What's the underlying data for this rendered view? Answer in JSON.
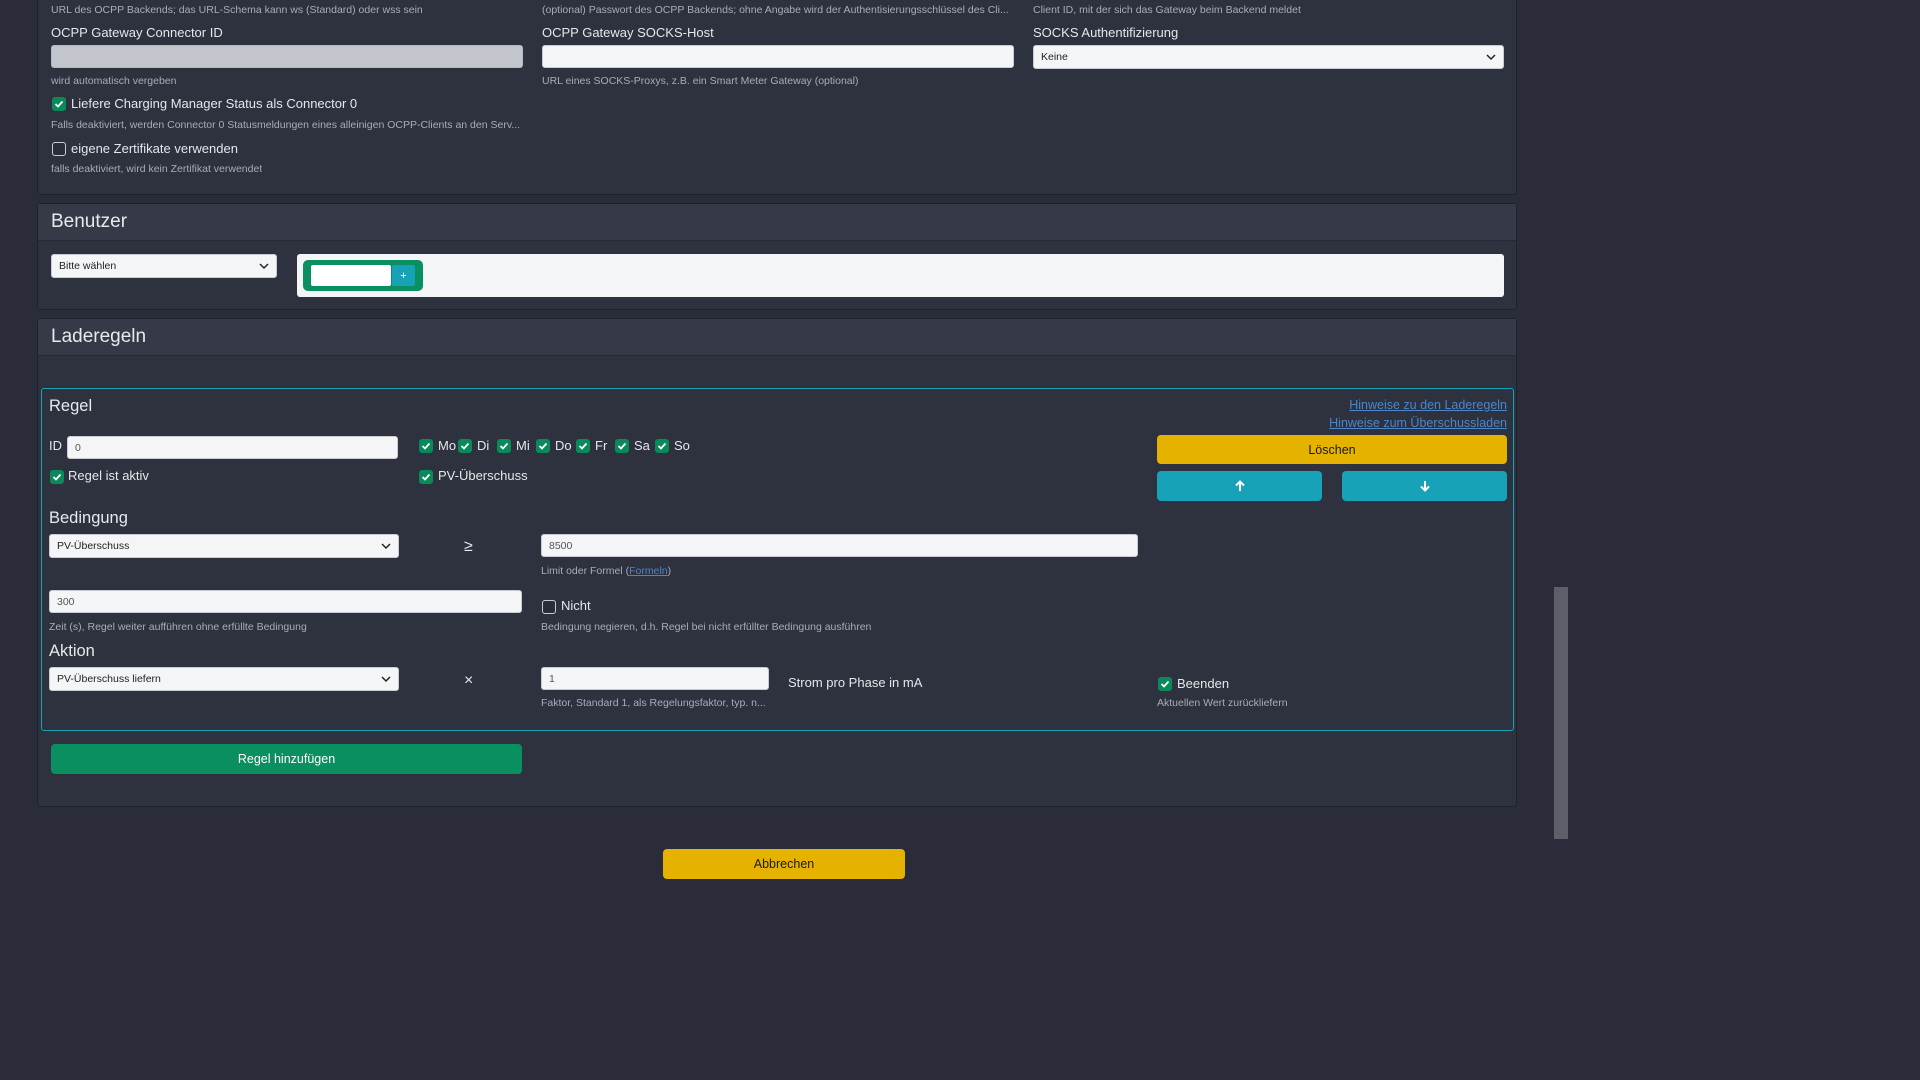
{
  "gateway": {
    "top_hints": {
      "url": "URL des OCPP Backends; das URL-Schema kann ws (Standard) oder wss sein",
      "password": "(optional) Passwort des OCPP Backends; ohne Angabe wird der Authentisierungsschlüssel des Cli...",
      "client_id": "Client ID, mit der sich das Gateway beim Backend meldet"
    },
    "connector_id_label": "OCPP Gateway Connector ID",
    "connector_id_value": "",
    "connector_id_hint": "wird automatisch vergeben",
    "socks_host_label": "OCPP Gateway SOCKS-Host",
    "socks_host_value": "",
    "socks_host_hint": "URL eines SOCKS-Proxys, z.B. ein Smart Meter Gateway (optional)",
    "socks_auth_label": "SOCKS Authentifizierung",
    "socks_auth_value": "Keine",
    "cm_status_label": "Liefere Charging Manager Status als Connector 0",
    "cm_status_checked": true,
    "cm_status_hint": "Falls deaktiviert, werden Connector 0 Statusmeldungen eines alleinigen OCPP-Clients an den Serv...",
    "own_certs_label": "eigene Zertifikate verwenden",
    "own_certs_checked": false,
    "own_certs_hint": "falls deaktiviert, wird kein Zertifikat verwendet"
  },
  "benutzer": {
    "title": "Benutzer",
    "select_value": "Bitte wählen",
    "tag_input_value": "",
    "add_label": "+"
  },
  "laderegeln": {
    "title": "Laderegeln",
    "rule": {
      "title": "Regel",
      "link_rules": "Hinweise zu den Laderegeln",
      "link_surplus": "Hinweise zum Überschussladen",
      "id_label": "ID",
      "id_value": "0",
      "days": [
        {
          "label": "Mo",
          "checked": true
        },
        {
          "label": "Di",
          "checked": true
        },
        {
          "label": "Mi",
          "checked": true
        },
        {
          "label": "Do",
          "checked": true
        },
        {
          "label": "Fr",
          "checked": true
        },
        {
          "label": "Sa",
          "checked": true
        },
        {
          "label": "So",
          "checked": true
        }
      ],
      "active_label": "Regel ist aktiv",
      "active_checked": true,
      "pv_label": "PV-Überschuss",
      "pv_checked": true,
      "delete_label": "Löschen",
      "condition_title": "Bedingung",
      "condition_select": "PV-Überschuss",
      "operator": "≥",
      "limit_value": "8500",
      "limit_hint_prefix": "Limit oder Formel (",
      "limit_hint_link": "Formeln",
      "limit_hint_suffix": ")",
      "time_value": "300",
      "time_hint": "Zeit (s), Regel weiter aufführen ohne erfüllte Bedingung",
      "not_label": "Nicht",
      "not_checked": false,
      "not_hint": "Bedingung negieren, d.h. Regel bei nicht erfüllter Bedingung ausführen",
      "action_title": "Aktion",
      "action_select": "PV-Überschuss liefern",
      "multiply": "×",
      "factor_value": "1",
      "factor_hint": "Faktor, Standard 1, als Regelungsfaktor, typ. n...",
      "unit_label": "Strom pro Phase in mA",
      "end_label": "Beenden",
      "end_checked": true,
      "end_hint": "Aktuellen Wert zurückliefern"
    },
    "add_rule_label": "Regel hinzufügen"
  },
  "footer": {
    "cancel_label": "Abbrechen"
  },
  "colors": {
    "background": "#2a2d39",
    "panel": "#2e313e",
    "accent_yellow": "#e6b200",
    "accent_teal": "#17a2b8",
    "accent_green": "#0a8f60",
    "rule_border": "#17a2b8",
    "link": "#4d86c8"
  }
}
